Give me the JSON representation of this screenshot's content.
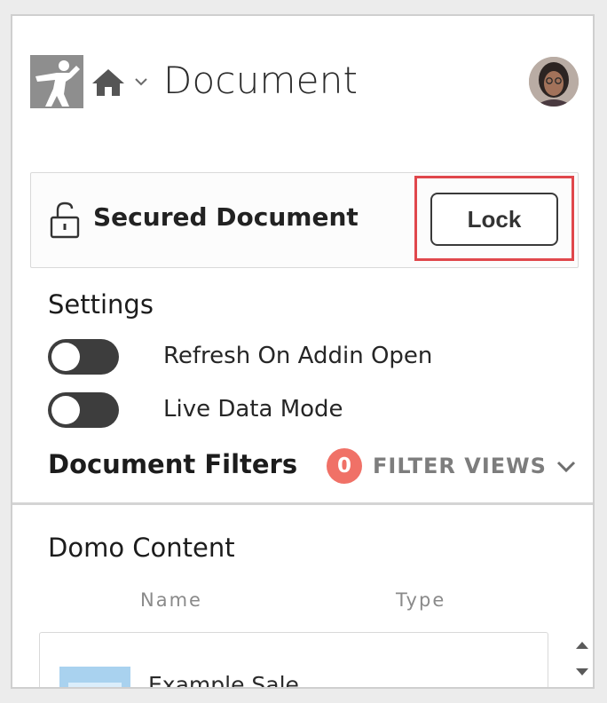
{
  "header": {
    "title": "Document",
    "logo_icon": "karate-silhouette-icon",
    "home_icon": "home-icon",
    "nav_chevron_icon": "chevron-down-icon"
  },
  "secured": {
    "label": "Secured Document",
    "icon": "unlock-icon",
    "lock_button": "Lock",
    "highlight_color": "#e0474c"
  },
  "settings": {
    "heading": "Settings",
    "toggles": [
      {
        "label": "Refresh On Addin Open",
        "on": false
      },
      {
        "label": "Live Data Mode",
        "on": false
      }
    ]
  },
  "filters": {
    "heading": "Document Filters",
    "count": "0",
    "views_label": "FILTER VIEWS",
    "badge_color": "#f07167"
  },
  "content": {
    "heading": "Domo Content",
    "columns": [
      "Name",
      "Type"
    ],
    "items": [
      {
        "name": "Example Sale"
      }
    ]
  }
}
